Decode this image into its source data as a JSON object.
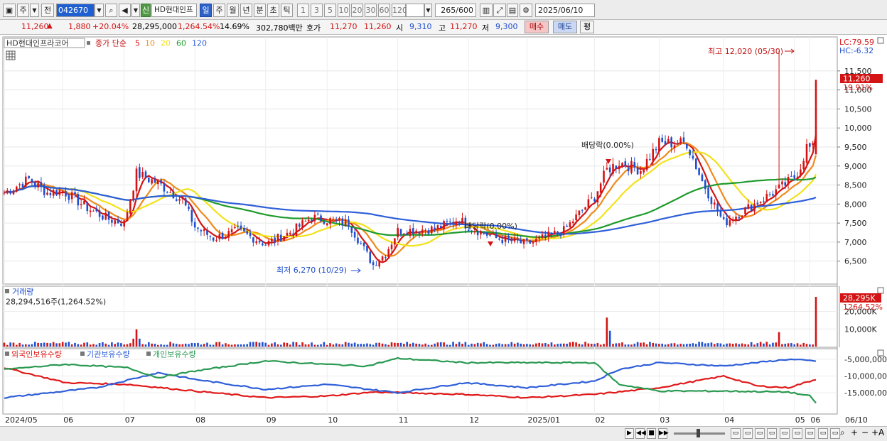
{
  "toolbar": {
    "period_label": "주",
    "prev_label": "전",
    "code": "042670",
    "new_badge": "신",
    "stock_name": "HD현대인프",
    "tabs": [
      "일",
      "주",
      "월",
      "년",
      "분",
      "초",
      "틱"
    ],
    "intervals": [
      "1",
      "3",
      "5",
      "10",
      "20",
      "30",
      "60",
      "120"
    ],
    "count_display": "265",
    "count_total": "/600",
    "date": "2025/06/10"
  },
  "quote": {
    "price": "11,260",
    "change": "1,880",
    "change_pct": "+20.04%",
    "volume": "28,295,000",
    "volume_pct": "1,264.54%",
    "turnover": "14.69%",
    "amount": "302,780백만",
    "bid_label": "호가",
    "ask": "11,270",
    "bid": "11,260",
    "open_label": "시",
    "open": "9,310",
    "high_label": "고",
    "high": "11,270",
    "low_label": "저",
    "low": "9,300",
    "buy_label": "매수",
    "sell_label": "매도",
    "eval_label": "평"
  },
  "colors": {
    "up": "#d41414",
    "down": "#1f4fcf",
    "ma5": "#d41414",
    "ma10": "#f08a1c",
    "ma20": "#f2e21a",
    "ma60": "#1f9a2c",
    "ma120": "#2f5fd8",
    "foreign": "#e01818",
    "institution": "#2f5fd8",
    "individual": "#2a9a52"
  },
  "price_panel": {
    "legend_name": "HD현대인프라코어",
    "legend_series": "종가 단순",
    "ma_periods": [
      "5",
      "10",
      "20",
      "60",
      "120"
    ],
    "lc": "LC:79.59",
    "hc": "HC:-6.32",
    "high_annotation": "최고 12,020 (05/30)",
    "low_annotation": "최저 6,270 (10/29)",
    "dividend_1": "배당락(0.00%)",
    "dividend_2": "배당락(0.00%)",
    "current_price_tag": "11,260",
    "current_pct_tag": "19.91%",
    "y_ticks": [
      "11,500",
      "11,000",
      "10,500",
      "10,000",
      "9,500",
      "9,000",
      "8,500",
      "8,000",
      "7,500",
      "7,000",
      "6,500"
    ]
  },
  "volume_panel": {
    "title": "거래량",
    "info": "28,294,516주(1,264.52%)",
    "tag_value": "28,295K",
    "tag_pct": "1264.52%",
    "y_ticks": [
      "20,000K",
      "10,000K"
    ]
  },
  "holdings_panel": {
    "series_labels": [
      "외국인보유수량",
      "기관보유수량",
      "개인보유수량"
    ],
    "y_ticks": [
      "-5,000,000",
      "-10,000,000",
      "-15,000,000"
    ]
  },
  "x_axis": {
    "labels": [
      "2024/05",
      "06",
      "07",
      "08",
      "09",
      "10",
      "11",
      "12",
      "2025/01",
      "02",
      "03",
      "04",
      "05",
      "06"
    ],
    "end_label": "06/10"
  },
  "chart_data": {
    "type": "candlestick",
    "x_range": [
      "2024/05",
      "2025/06/10"
    ],
    "y_range": [
      6100,
      12100
    ],
    "annotations": [
      {
        "label": "최고",
        "value": 12020,
        "date": "05/30"
      },
      {
        "label": "최저",
        "value": 6270,
        "date": "10/29"
      }
    ],
    "price_anchors": [
      {
        "date": "2024/05",
        "close": 8300
      },
      {
        "date": "2024/06",
        "close": 8350
      },
      {
        "date": "2024/07",
        "close": 7500
      },
      {
        "date": "2024/07 late",
        "close": 8700
      },
      {
        "date": "2024/08",
        "close": 7400
      },
      {
        "date": "2024/09",
        "close": 7000
      },
      {
        "date": "2024/10",
        "close": 7650
      },
      {
        "date": "2024/10/29",
        "close": 6270
      },
      {
        "date": "2024/11",
        "close": 7300
      },
      {
        "date": "2024/12",
        "close": 7100
      },
      {
        "date": "2025/01",
        "close": 6950
      },
      {
        "date": "2025/02",
        "close": 8200
      },
      {
        "date": "2025/02 mid",
        "close": 9100
      },
      {
        "date": "2025/03",
        "close": 9600
      },
      {
        "date": "2025/04",
        "close": 7500
      },
      {
        "date": "2025/05",
        "close": 8700
      },
      {
        "date": "2025/05/30",
        "close": 9600
      },
      {
        "date": "2025/06/10",
        "close": 11260
      }
    ],
    "series": [
      {
        "name": "5",
        "type": "moving-average"
      },
      {
        "name": "10",
        "type": "moving-average"
      },
      {
        "name": "20",
        "type": "moving-average"
      },
      {
        "name": "60",
        "type": "moving-average"
      },
      {
        "name": "120",
        "type": "moving-average"
      }
    ],
    "volume_last": 28295000
  }
}
